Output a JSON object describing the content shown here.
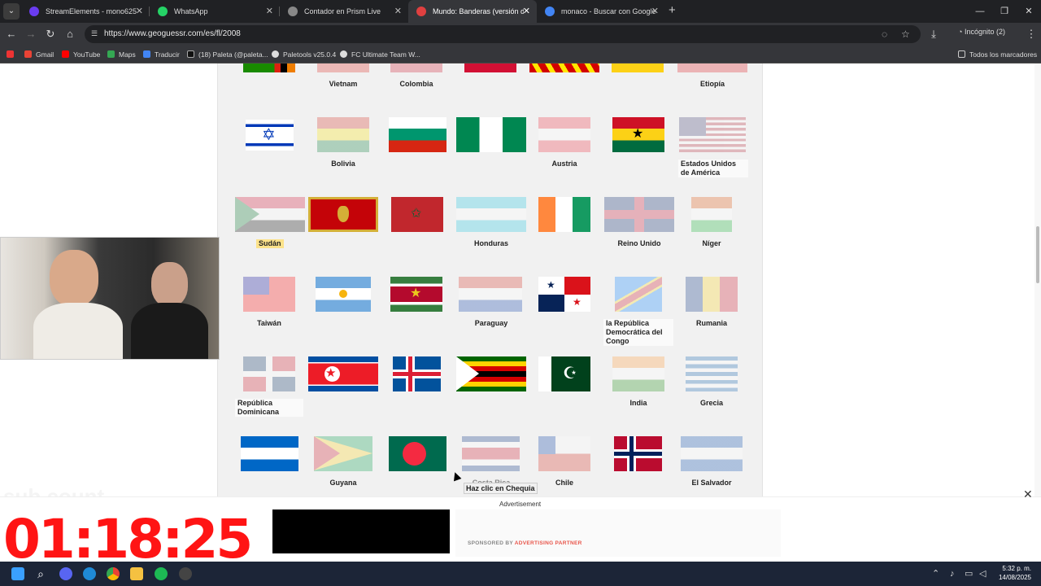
{
  "tabs": [
    {
      "title": "StreamElements - mono625",
      "color": "#6a3cf0"
    },
    {
      "title": "WhatsApp",
      "color": "#25d366"
    },
    {
      "title": "Contador en Prism Live",
      "color": "#888888"
    },
    {
      "title": "Mundo: Banderas (versión difícil)",
      "color": "#e04040"
    },
    {
      "title": "monaco - Buscar con Google",
      "color": "#4285f4"
    }
  ],
  "address": {
    "url": "https://www.geoguessr.com/es/fl/2008",
    "incognito": "Incógnito (2)"
  },
  "bookmarks": [
    {
      "label": "Gmail",
      "color": "#ea4335"
    },
    {
      "label": "YouTube",
      "color": "#ff0000"
    },
    {
      "label": "Maps",
      "color": "#34a853"
    },
    {
      "label": "Traducir",
      "color": "#4285f4"
    },
    {
      "label": "(18) Paleta (@paleta...",
      "color": "#111111"
    },
    {
      "label": "Paletools v25.0.4",
      "color": "#dddddd"
    },
    {
      "label": "FC Ultimate Team W...",
      "color": "#dddddd"
    }
  ],
  "bookmarks_all": "Todos los marcadores",
  "labels": {
    "vietnam": "Vietnam",
    "colombia": "Colombia",
    "etiopia": "Etiopía",
    "bolivia": "Bolivia",
    "austria": "Austria",
    "usa": "Estados Unidos de América",
    "sudan": "Sudán",
    "honduras": "Honduras",
    "uk": "Reino Unido",
    "niger": "Níger",
    "taiwan": "Taiwán",
    "paraguay": "Paraguay",
    "drc": "la República Democrática del Congo",
    "rumania": "Rumania",
    "domrep": "República Dominicana",
    "india": "India",
    "grecia": "Grecia",
    "guyana": "Guyana",
    "costarica": "Costa Rica",
    "chile": "Chile",
    "elsalvador": "El Salvador"
  },
  "tooltip": "Haz clic en Chequia",
  "ad": {
    "label": "Advertisement",
    "sponsor_prefix": "SPONSORED BY",
    "sponsor_name": "ADVERTISING PARTNER"
  },
  "timer": "01:18:25",
  "ghost": "sub count",
  "clock": {
    "time": "5:32 p. m.",
    "date": "14/08/2025"
  }
}
